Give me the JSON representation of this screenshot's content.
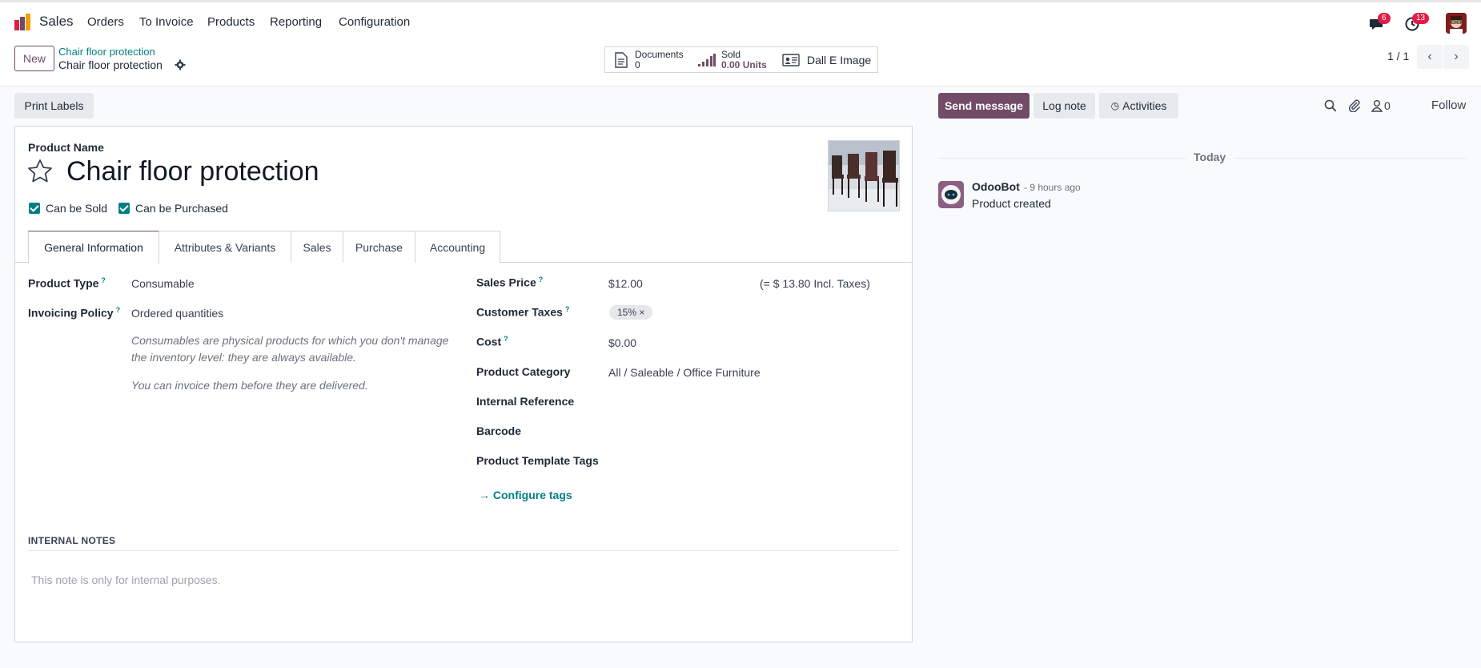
{
  "topbar": {
    "app_name": "Sales",
    "menu": [
      "Orders",
      "To Invoice",
      "Products",
      "Reporting",
      "Configuration"
    ],
    "messages_badge": "6",
    "activities_badge": "13"
  },
  "control": {
    "new_label": "New",
    "breadcrumb_parent": "Chair floor protection",
    "breadcrumb_current": "Chair floor protection",
    "smart_buttons": {
      "documents_label": "Documents",
      "documents_value": "0",
      "sold_label": "Sold",
      "sold_value": "0.00 Units",
      "dalle_label": "Dall E Image"
    },
    "pager": "1 / 1"
  },
  "form": {
    "print_labels": "Print Labels",
    "product_name_label": "Product Name",
    "product_name": "Chair floor protection",
    "can_be_sold": "Can be Sold",
    "can_be_purchased": "Can be Purchased",
    "tabs": [
      "General Information",
      "Attributes & Variants",
      "Sales",
      "Purchase",
      "Accounting"
    ],
    "left": {
      "product_type_label": "Product Type",
      "product_type": "Consumable",
      "invoicing_policy_label": "Invoicing Policy",
      "invoicing_policy": "Ordered quantities",
      "help_1": "Consumables are physical products for which you don't manage the inventory level: they are always available.",
      "help_2": "You can invoice them before they are delivered."
    },
    "right": {
      "sales_price_label": "Sales Price",
      "sales_price": "$12.00",
      "incl_taxes": "(= $ 13.80 Incl. Taxes)",
      "customer_taxes_label": "Customer Taxes",
      "customer_tax_tag": "15%",
      "cost_label": "Cost",
      "cost": "$0.00",
      "product_category_label": "Product Category",
      "product_category": "All / Saleable / Office Furniture",
      "internal_reference_label": "Internal Reference",
      "barcode_label": "Barcode",
      "template_tags_label": "Product Template Tags",
      "configure_tags": "Configure tags"
    },
    "internal_notes_title": "INTERNAL NOTES",
    "internal_notes_placeholder": "This note is only for internal purposes."
  },
  "chatter": {
    "send_message": "Send message",
    "log_note": "Log note",
    "activities": "Activities",
    "followers_count": "0",
    "follow": "Follow",
    "date_separator": "Today",
    "author": "OdooBot",
    "time": "- 9 hours ago",
    "message": "Product created"
  },
  "colors": {
    "brand": "#714B67",
    "teal": "#017e84",
    "badge": "#e11d48"
  }
}
